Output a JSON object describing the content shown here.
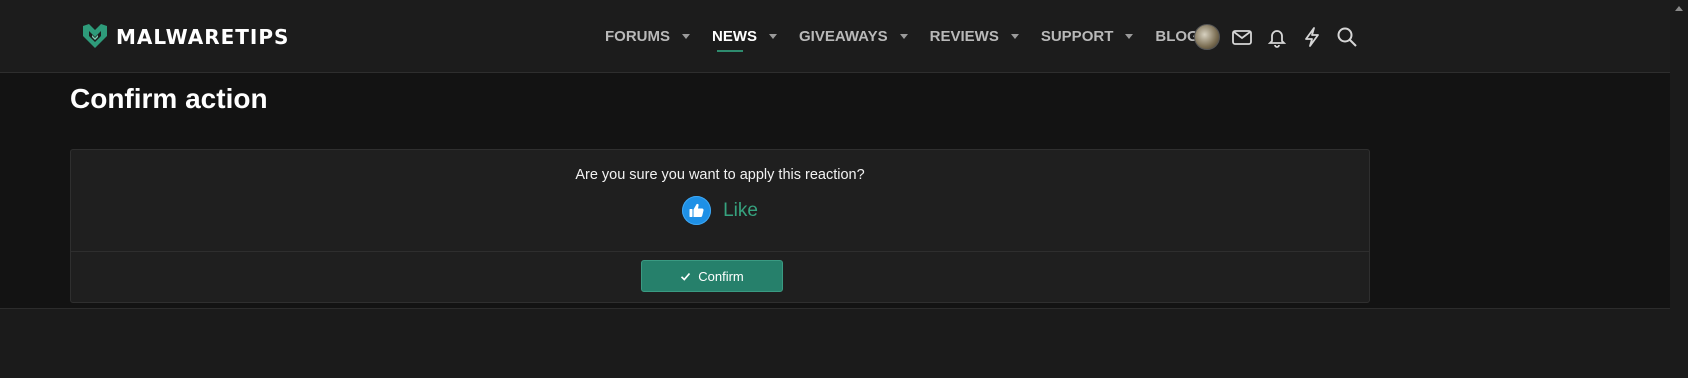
{
  "header": {
    "logo_text": "MALWARETIPS",
    "nav": [
      {
        "label": "FORUMS",
        "dropdown": true,
        "active": false
      },
      {
        "label": "NEWS",
        "dropdown": true,
        "active": true
      },
      {
        "label": "GIVEAWAYS",
        "dropdown": true,
        "active": false
      },
      {
        "label": "REVIEWS",
        "dropdown": true,
        "active": false
      },
      {
        "label": "SUPPORT",
        "dropdown": true,
        "active": false
      },
      {
        "label": "BLOGS",
        "dropdown": false,
        "active": false
      }
    ],
    "icons": [
      "avatar",
      "envelope-icon",
      "bell-icon",
      "lightning-icon",
      "search-icon"
    ]
  },
  "page": {
    "title": "Confirm action",
    "question": "Are you sure you want to apply this reaction?",
    "reaction_label": "Like",
    "reaction_icon": "thumbs-up-icon",
    "confirm_label": "Confirm"
  },
  "colors": {
    "accent": "#2e8b6e",
    "button": "#26806b",
    "like_blue": "#1e90e6",
    "background": "#131313"
  }
}
